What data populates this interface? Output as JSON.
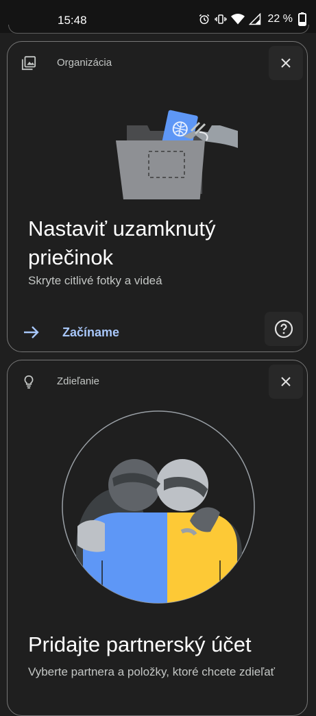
{
  "status_bar": {
    "time": "15:48",
    "battery_percent": "22 %",
    "icons": [
      "alarm-icon",
      "vibrate-icon",
      "wifi-icon",
      "signal-icon",
      "battery-icon"
    ]
  },
  "cards": [
    {
      "category": "Organizácia",
      "category_icon": "photo-library-icon",
      "title": "Nastaviť uzamknutý priečinok",
      "subtitle": "Skryte citlivé fotky a videá",
      "action_label": "Začíname",
      "action_icon": "arrow-right-icon",
      "help_icon": "help-icon",
      "close_icon": "close-icon"
    },
    {
      "category": "Zdieľanie",
      "category_icon": "lightbulb-icon",
      "title": "Pridajte partnerský účet",
      "subtitle": "Vyberte partnera a položky, ktoré chcete zdieľať",
      "close_icon": "close-icon"
    }
  ],
  "colors": {
    "background": "#1f1f1f",
    "accent": "#a8c7fa",
    "blue": "#5e97f6",
    "yellow": "#fdc936"
  }
}
